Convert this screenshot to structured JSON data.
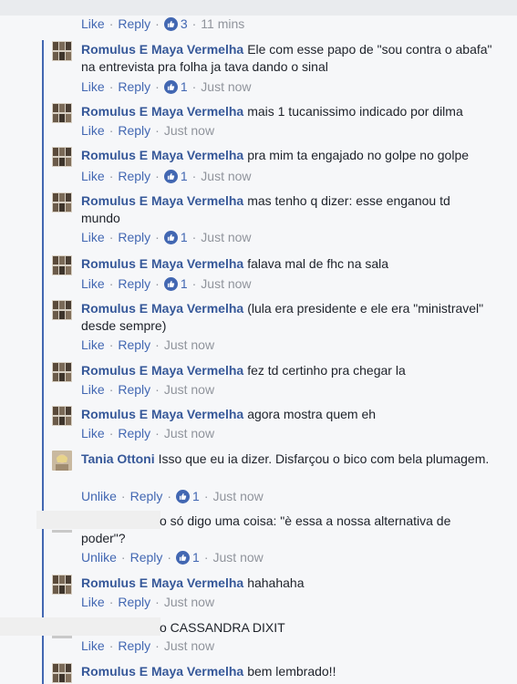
{
  "actions": {
    "like": "Like",
    "unlike": "Unlike",
    "reply": "Reply",
    "sep": "·"
  },
  "top_row": {
    "likes": "3",
    "time": "11 mins"
  },
  "comments": [
    {
      "author": "Romulus E Maya Vermelha",
      "text": "Ele com esse papo de \"sou contra o abafa\" na entrevista pra folha ja tava dando o sinal",
      "likes": "1",
      "time": "Just now"
    },
    {
      "author": "Romulus E Maya Vermelha",
      "text": "mais 1 tucanissimo indicado por dilma",
      "likes": "",
      "time": "Just now"
    },
    {
      "author": "Romulus E Maya Vermelha",
      "text": "pra mim ta engajado no golpe no golpe",
      "likes": "1",
      "time": "Just now"
    },
    {
      "author": "Romulus E Maya Vermelha",
      "text": "mas tenho q dizer: esse enganou td mundo",
      "likes": "1",
      "time": "Just now"
    },
    {
      "author": "Romulus E Maya Vermelha",
      "text": "falava mal de fhc na sala",
      "likes": "1",
      "time": "Just now"
    },
    {
      "author": "Romulus E Maya Vermelha",
      "text": "(lula era presidente e ele era \"ministravel\" desde sempre)",
      "likes": "",
      "time": "Just now"
    },
    {
      "author": "Romulus E Maya Vermelha",
      "text": "fez td certinho pra chegar la",
      "likes": "",
      "time": "Just now"
    },
    {
      "author": "Romulus E Maya Vermelha",
      "text": "agora mostra quem eh",
      "likes": "",
      "time": "Just now"
    },
    {
      "author": "Tania Ottoni",
      "text": "Isso que eu ia dizer. Disfarçou o bico com bela plumagem.",
      "likes": "1",
      "time": "Just now"
    },
    {
      "author": "",
      "text": "o só digo uma coisa: \"è essa a nossa alternativa de poder\"?",
      "likes": "1",
      "time": "Just now"
    },
    {
      "author": "Romulus E Maya Vermelha",
      "text": "hahahaha",
      "likes": "",
      "time": "Just now"
    },
    {
      "author": "",
      "text": "o CASSANDRA DIXIT",
      "likes": "",
      "time": "Just now"
    },
    {
      "author": "Romulus E Maya Vermelha",
      "text": "bem lembrado!!",
      "likes": "",
      "time": ""
    }
  ],
  "colors": {
    "link": "#4267b2",
    "author": "#365899",
    "thread_line": "#4267b2",
    "background": "#f6f7f9"
  }
}
